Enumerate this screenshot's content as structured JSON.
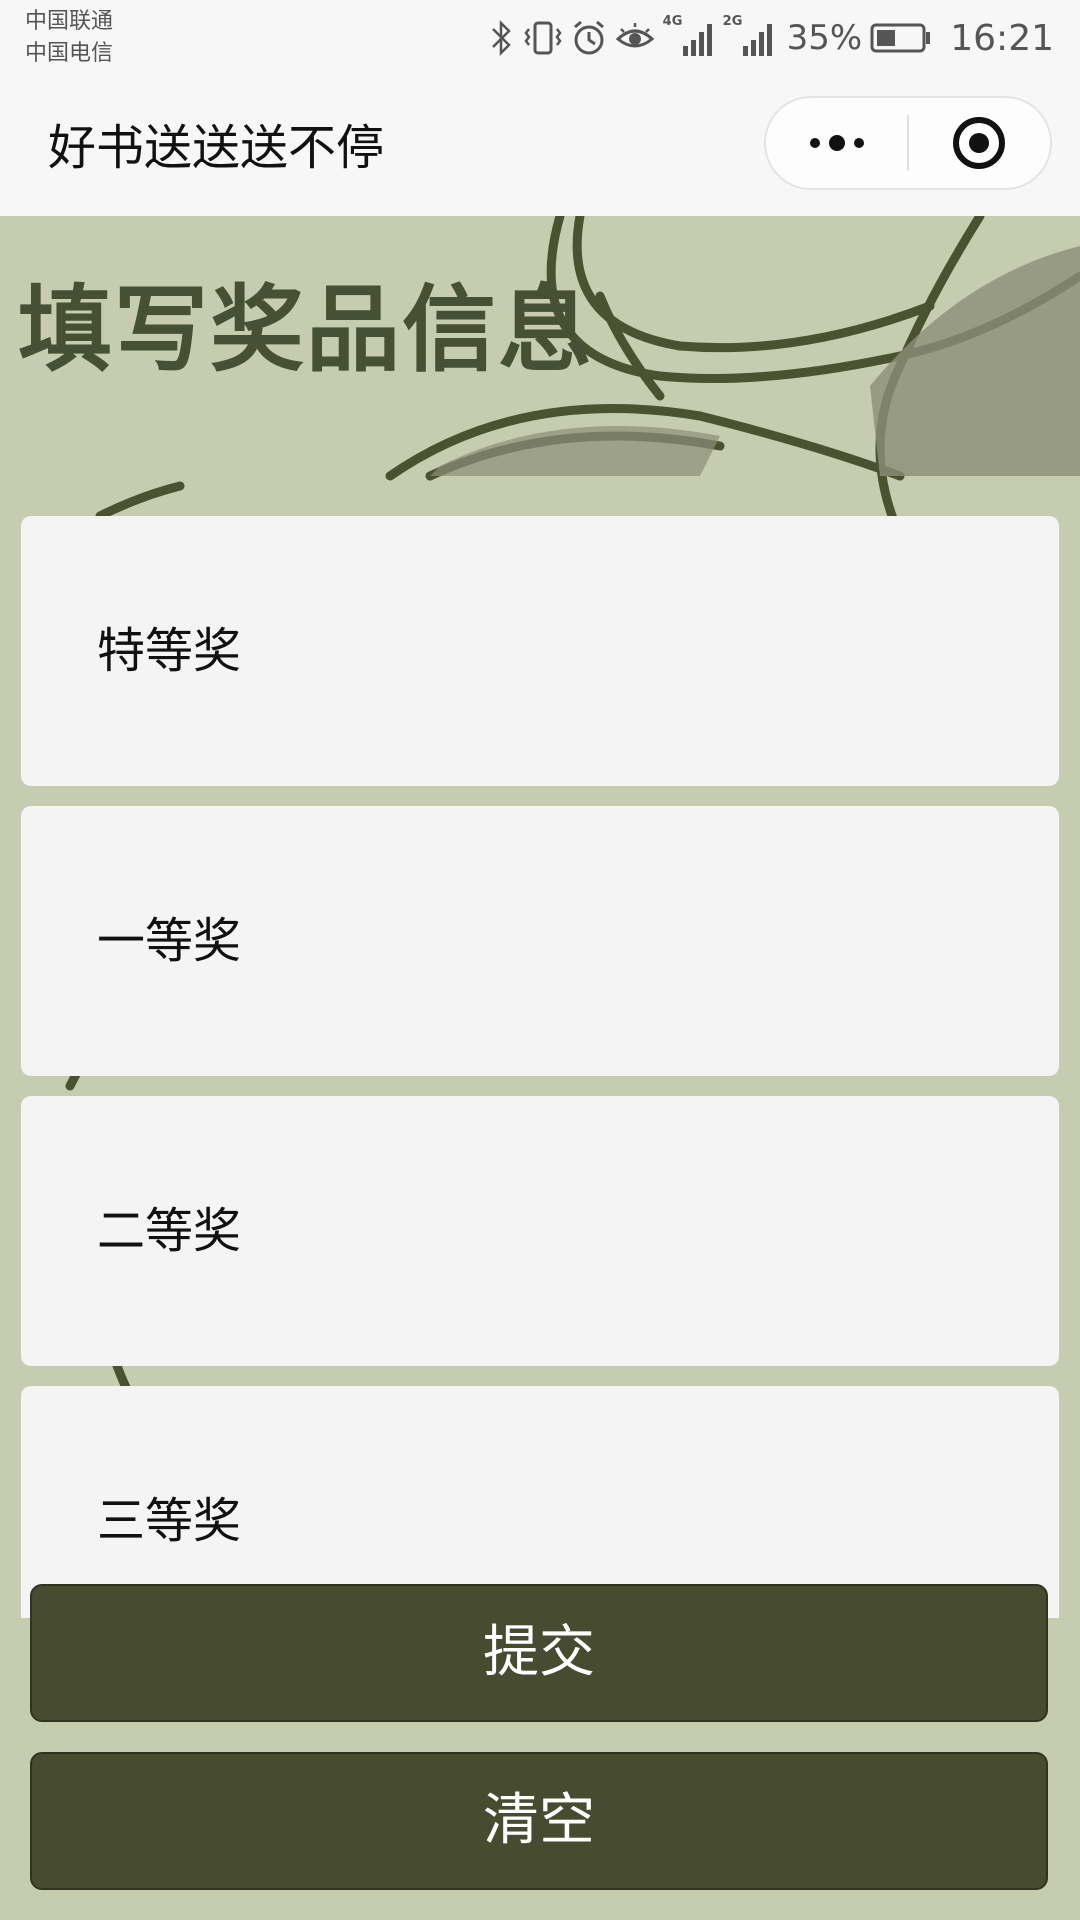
{
  "status_bar": {
    "carrier_1": "中国联通",
    "carrier_2": "中国电信",
    "network_1": "4G",
    "network_2": "2G",
    "battery": "35%",
    "time": "16:21",
    "icons": [
      "bluetooth-icon",
      "vibrate-icon",
      "alarm-icon",
      "eye-comfort-icon",
      "signal-icon",
      "battery-icon"
    ]
  },
  "nav": {
    "title": "好书送送送不停",
    "more_icon": "more-dots-icon",
    "close_icon": "target-close-icon"
  },
  "main": {
    "heading": "填写奖品信息",
    "prizes": [
      {
        "label": "特等奖"
      },
      {
        "label": "一等奖"
      },
      {
        "label": "二等奖"
      },
      {
        "label": "三等奖"
      }
    ],
    "submit_label": "提交",
    "clear_label": "清空"
  },
  "colors": {
    "background": "#c6ccb0",
    "heading": "#465034",
    "button": "#474c30",
    "card": "#f4f4f4"
  }
}
